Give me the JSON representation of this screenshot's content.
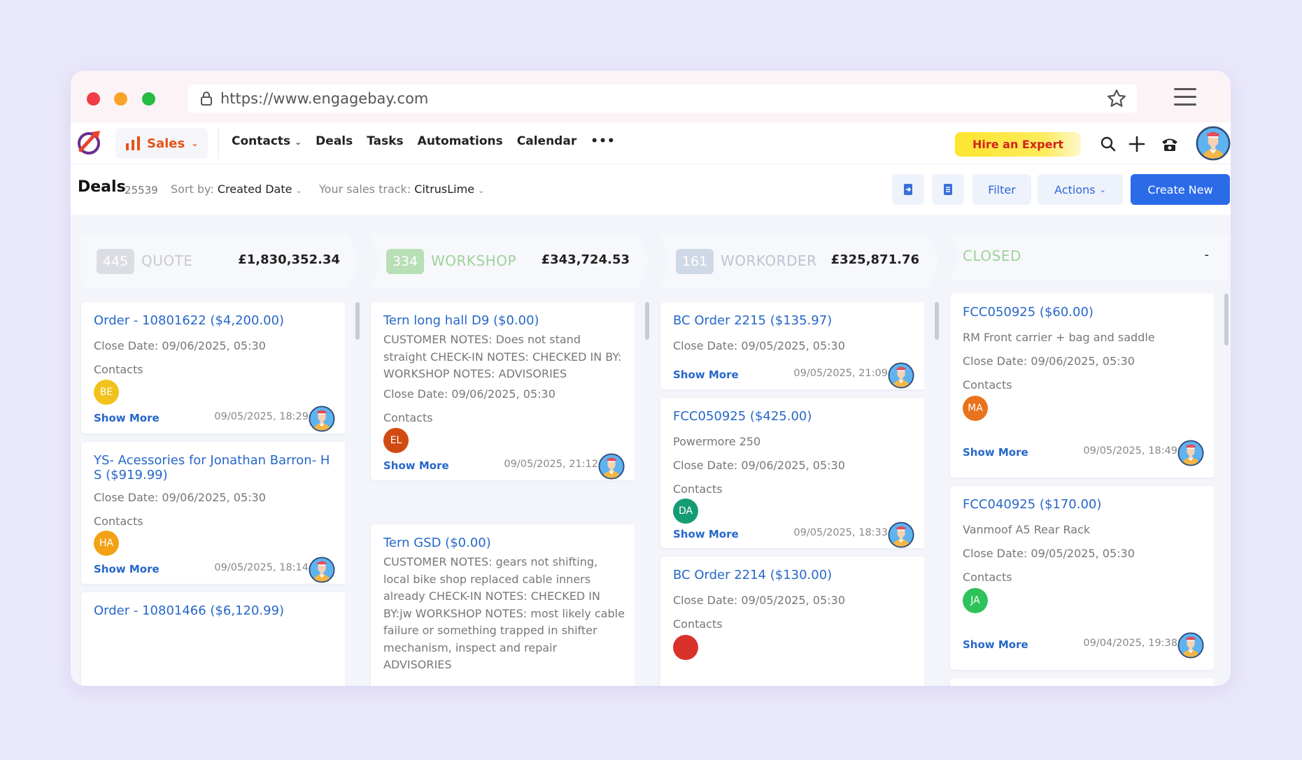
{
  "browser": {
    "url": "https://www.engagebay.com"
  },
  "nav": {
    "module": "Sales",
    "items": [
      "Contacts",
      "Deals",
      "Tasks",
      "Automations",
      "Calendar",
      "•••"
    ],
    "hire_expert": "Hire an Expert"
  },
  "toolbar": {
    "title": "Deals",
    "count": "25539",
    "sort_label": "Sort by:",
    "sort_value": "Created Date",
    "track_label": "Your sales track:",
    "track_value": "CitrusLime",
    "filter": "Filter",
    "actions": "Actions",
    "create": "Create New"
  },
  "columns": [
    {
      "name": "QUOTE",
      "count": "445",
      "total": "£1,830,352.34",
      "badge_color": "#dcdde3",
      "name_color": "#c9cad1",
      "cards": [
        {
          "title": "Order - 10801622 ($4,200.00)",
          "close": "Close Date: 09/06/2025, 05:30",
          "contacts_label": "Contacts",
          "contact": "BE",
          "contact_color": "#f1c21b",
          "show_more": "Show More",
          "date": "09/05/2025, 18:29"
        },
        {
          "title": "YS- Acessories for Jonathan Barron- H S ($919.99)",
          "close": "Close Date: 09/06/2025, 05:30",
          "contacts_label": "Contacts",
          "contact": "HA",
          "contact_color": "#f3a116",
          "show_more": "Show More",
          "date": "09/05/2025, 18:14"
        },
        {
          "title": "Order - 10801466 ($6,120.99)"
        }
      ]
    },
    {
      "name": "WORKSHOP",
      "count": "334",
      "total": "£343,724.53",
      "badge_color": "#b8dfb5",
      "name_color": "#9fd29b",
      "cards": [
        {
          "title": "Tern long hall D9 ($0.00)",
          "note": "CUSTOMER NOTES: Does not stand straight CHECK-IN NOTES: CHECKED IN BY: WORKSHOP NOTES: ADVISORIES",
          "close": "Close Date: 09/06/2025, 05:30",
          "contacts_label": "Contacts",
          "contact": "EL",
          "contact_color": "#d14a12",
          "show_more": "Show More",
          "date": "09/05/2025, 21:12"
        },
        {
          "title": "Tern GSD ($0.00)",
          "note": "CUSTOMER NOTES: gears not shifting, local bike shop replaced cable inners already CHECK-IN NOTES: CHECKED IN BY:jw WORKSHOP NOTES: most likely cable failure or something trapped in shifter mechanism, inspect and repair ADVISORIES"
        }
      ]
    },
    {
      "name": "WORKORDER",
      "count": "161",
      "total": "£325,871.76",
      "badge_color": "#cfd8e6",
      "name_color": "#bcc4d2",
      "cards": [
        {
          "title": "BC Order 2215 ($135.97)",
          "close": "Close Date: 09/05/2025, 05:30",
          "show_more": "Show More",
          "date": "09/05/2025, 21:09"
        },
        {
          "title": "FCC050925 ($425.00)",
          "subtitle": "Powermore 250",
          "close": "Close Date: 09/06/2025, 05:30",
          "contacts_label": "Contacts",
          "contact": "DA",
          "contact_color": "#169c74",
          "show_more": "Show More",
          "date": "09/05/2025, 18:33"
        },
        {
          "title": "BC Order 2214 ($130.00)",
          "close": "Close Date: 09/05/2025, 05:30",
          "contacts_label": "Contacts"
        }
      ]
    },
    {
      "name": "CLOSED",
      "total": "-",
      "name_color": "#9fd29b",
      "cards": [
        {
          "title": "FCC050925 ($60.00)",
          "subtitle": "RM Front carrier + bag and saddle",
          "close": "Close Date: 09/06/2025, 05:30",
          "contacts_label": "Contacts",
          "contact": "MA",
          "contact_color": "#e8731c",
          "show_more": "Show More",
          "date": "09/05/2025, 18:49"
        },
        {
          "title": "FCC040925 ($170.00)",
          "subtitle": "Vanmoof A5 Rear Rack",
          "close": "Close Date: 09/05/2025, 05:30",
          "contacts_label": "Contacts",
          "contact": "JA",
          "contact_color": "#2fc25b",
          "show_more": "Show More",
          "date": "09/04/2025, 19:38"
        }
      ]
    }
  ]
}
